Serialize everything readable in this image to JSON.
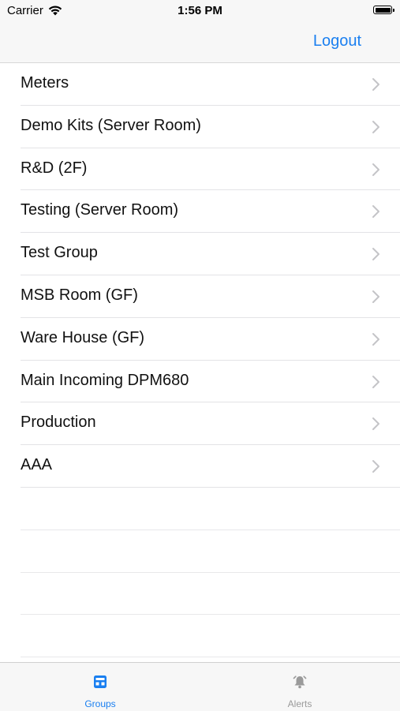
{
  "status_bar": {
    "carrier": "Carrier",
    "time": "1:56 PM"
  },
  "nav": {
    "logout_label": "Logout"
  },
  "groups": [
    {
      "label": "Meters"
    },
    {
      "label": "Demo Kits (Server Room)"
    },
    {
      "label": "R&D (2F)"
    },
    {
      "label": "Testing (Server Room)"
    },
    {
      "label": "Test Group"
    },
    {
      "label": "MSB Room (GF)"
    },
    {
      "label": "Ware House (GF)"
    },
    {
      "label": "Main Incoming DPM680"
    },
    {
      "label": "Production"
    },
    {
      "label": "AAA"
    }
  ],
  "tabs": [
    {
      "label": "Groups",
      "icon": "groups-icon",
      "selected": true
    },
    {
      "label": "Alerts",
      "icon": "bell-icon",
      "selected": false
    }
  ],
  "colors": {
    "accent": "#1a7ff0",
    "inactive": "#9a9a9a"
  }
}
